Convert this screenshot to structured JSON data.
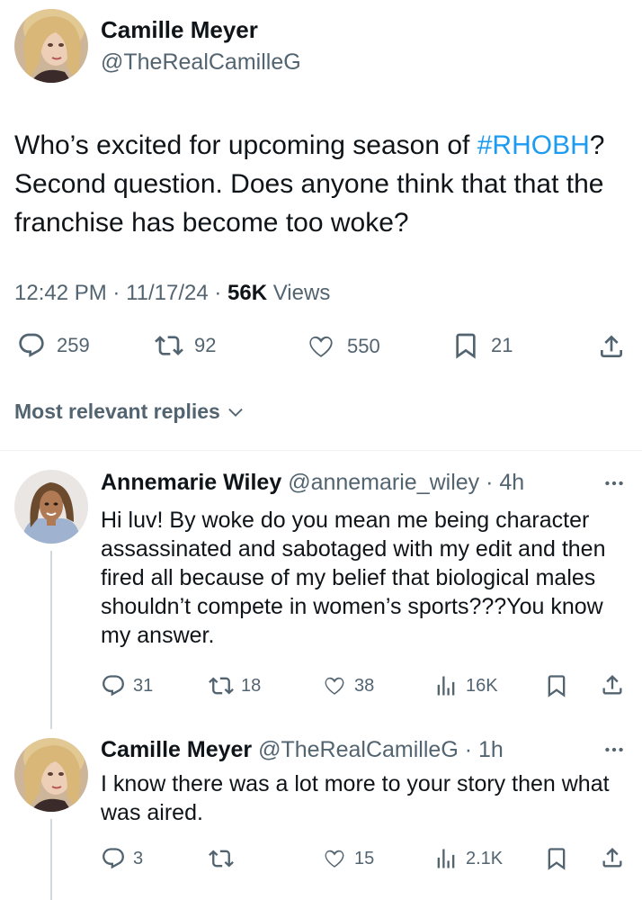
{
  "tweet": {
    "author_name": "Camille Meyer",
    "author_handle": "@TheRealCamilleG",
    "text_before": "Who’s excited for upcoming season of ",
    "hashtag": "#RHOBH",
    "text_after": "? Second question. Does anyone think that that the franchise has become too woke?",
    "time": "12:42 PM",
    "date": "11/17/24",
    "views_count": "56K",
    "views_label": "Views",
    "separator": " · ",
    "stats": {
      "replies": "259",
      "reposts": "92",
      "likes": "550",
      "bookmarks": "21"
    }
  },
  "replies_header": {
    "label": "Most relevant replies"
  },
  "replies": [
    {
      "author_name": "Annemarie Wiley",
      "author_handle": "@annemarie_wiley",
      "time": "4h",
      "text": "Hi luv! By woke do you mean me being character assassinated and sabotaged with my edit and then fired all because of my belief that biological males shouldn’t compete in women’s sports???You know my answer.",
      "stats": {
        "replies": "31",
        "reposts": "18",
        "likes": "38",
        "views": "16K"
      }
    },
    {
      "author_name": "Camille Meyer",
      "author_handle": "@TheRealCamilleG",
      "time": "1h",
      "text": "I know there was a lot more to your story then what was aired.",
      "stats": {
        "replies": "3",
        "reposts": "",
        "likes": "15",
        "views": "2.1K"
      }
    }
  ],
  "icons": {
    "reply": "speech-bubble-icon",
    "repost": "repost-arrows-icon",
    "like": "heart-icon",
    "bookmark": "bookmark-icon",
    "share": "share-arrow-icon",
    "views": "bar-chart-icon",
    "more": "ellipsis-icon",
    "dropdown": "chevron-down-icon"
  },
  "colors": {
    "accent": "#1d9bf0",
    "text": "#0f1419",
    "secondary": "#536471",
    "divider": "#eff3f4"
  }
}
